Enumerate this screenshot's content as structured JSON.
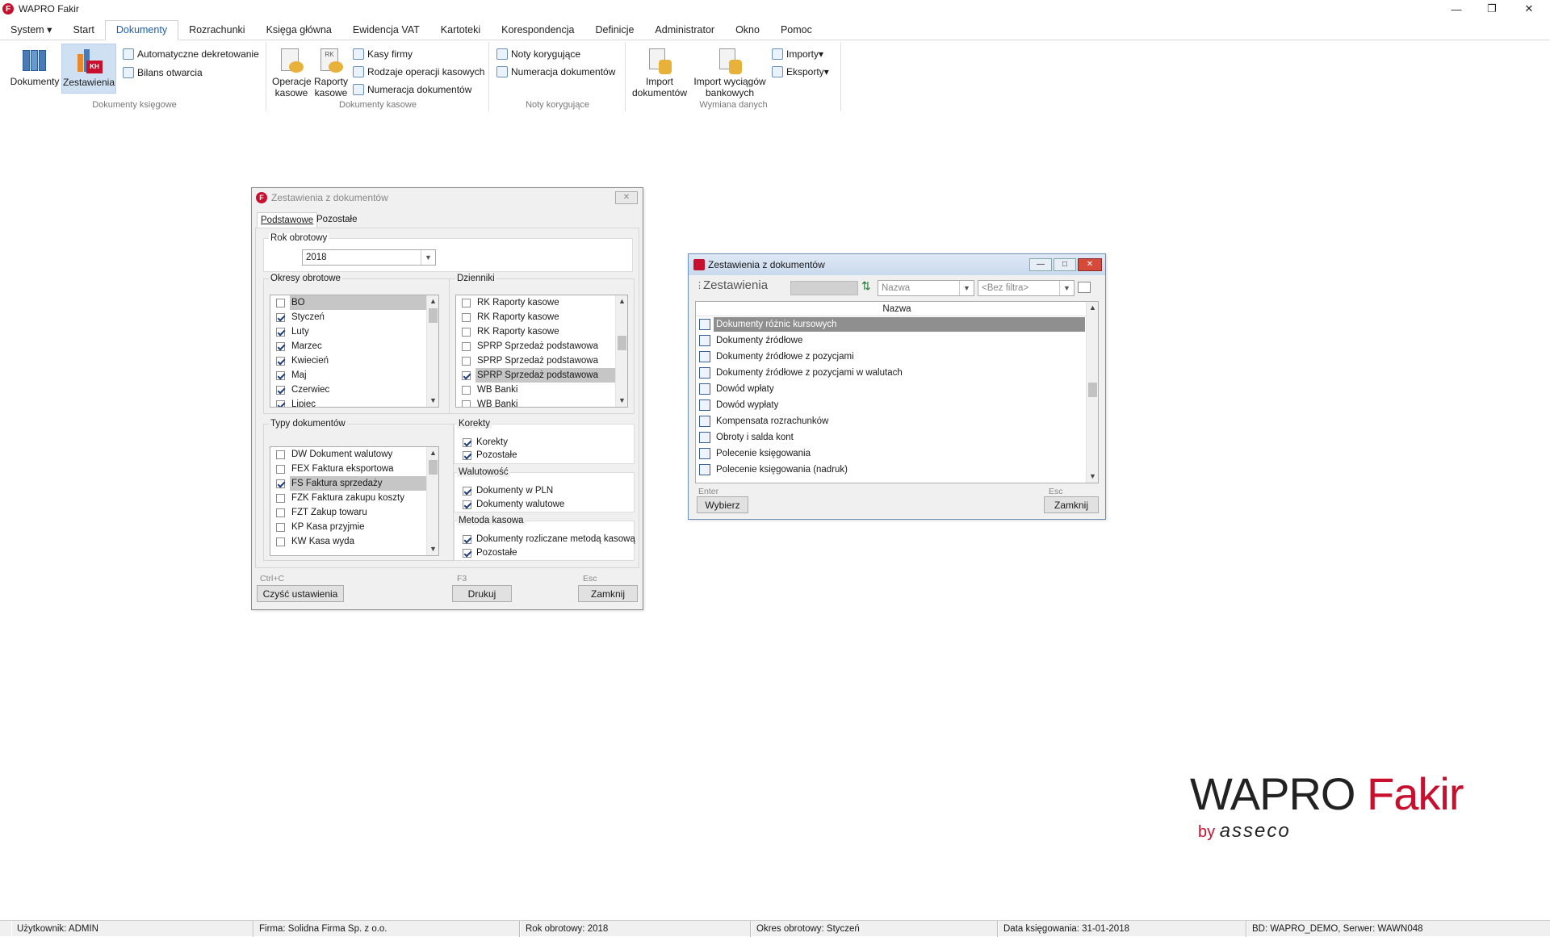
{
  "app": {
    "title": "WAPRO Fakir",
    "icon_letter": "F"
  },
  "menu": [
    "System",
    "Start",
    "Dokumenty",
    "Rozrachunki",
    "Księga główna",
    "Ewidencja VAT",
    "Kartoteki",
    "Korespondencja",
    "Definicje",
    "Administrator",
    "Okno",
    "Pomoc"
  ],
  "ribbon": {
    "g1": {
      "label": "Dokumenty księgowe",
      "btn1": "Dokumenty",
      "btn2": "Zestawienia",
      "btn2_badge": "KH",
      "s1": "Automatyczne dekretowanie",
      "s2": "Bilans otwarcia"
    },
    "g2": {
      "label": "Dokumenty kasowe",
      "b1a": "Operacje",
      "b1b": "kasowe",
      "b2a": "Raporty",
      "b2b": "kasowe",
      "s1": "Kasy firmy",
      "s2": "Rodzaje operacji kasowych",
      "s3": "Numeracja dokumentów"
    },
    "g3": {
      "label": "Noty korygujące",
      "s1": "Noty korygujące",
      "s2": "Numeracja dokumentów"
    },
    "g4": {
      "label": "Wymiana danych",
      "b1a": "Import",
      "b1b": "dokumentów",
      "b2a": "Import wyciągów",
      "b2b": "bankowych",
      "s1": "Importy",
      "s2": "Eksporty"
    }
  },
  "dialog1": {
    "title": "Zestawienia z dokumentów",
    "tabs": [
      "Podstawowe",
      "Pozostałe"
    ],
    "rok_label": "Rok obrotowy",
    "rok_value": "2018",
    "okresy_label": "Okresy obrotowe",
    "okresy": [
      {
        "t": "BO",
        "c": false,
        "s": true
      },
      {
        "t": "Styczeń",
        "c": true
      },
      {
        "t": "Luty",
        "c": true
      },
      {
        "t": "Marzec",
        "c": true
      },
      {
        "t": "Kwiecień",
        "c": true
      },
      {
        "t": "Maj",
        "c": true
      },
      {
        "t": "Czerwiec",
        "c": true
      },
      {
        "t": "Lipiec",
        "c": true
      }
    ],
    "dzienniki_label": "Dzienniki",
    "dzienniki": [
      {
        "t": "RK Raporty kasowe",
        "c": false
      },
      {
        "t": "RK Raporty kasowe",
        "c": false
      },
      {
        "t": "RK Raporty kasowe",
        "c": false
      },
      {
        "t": "SPRP Sprzedaż podstawowa",
        "c": false
      },
      {
        "t": "SPRP Sprzedaż podstawowa",
        "c": false
      },
      {
        "t": "SPRP Sprzedaż podstawowa",
        "c": true,
        "s": true
      },
      {
        "t": "WB Banki",
        "c": false
      },
      {
        "t": "WB Banki",
        "c": false
      }
    ],
    "typy_label": "Typy dokumentów",
    "typy": [
      {
        "t": "DW Dokument walutowy",
        "c": false
      },
      {
        "t": "FEX Faktura eksportowa",
        "c": false
      },
      {
        "t": "FS Faktura sprzedaży",
        "c": true,
        "s": true
      },
      {
        "t": "FZK Faktura zakupu koszty",
        "c": false
      },
      {
        "t": "FZT Zakup towaru",
        "c": false
      },
      {
        "t": "KP Kasa przyjmie",
        "c": false
      },
      {
        "t": "KW Kasa wyda",
        "c": false
      }
    ],
    "korekty_label": "Korekty",
    "korekty": [
      "Korekty",
      "Pozostałe"
    ],
    "walutowosc_label": "Walutowość",
    "walutowosc": [
      "Dokumenty w PLN",
      "Dokumenty walutowe"
    ],
    "metoda_label": "Metoda kasowa",
    "metoda": [
      "Dokumenty rozliczane metodą kasową",
      "Pozostałe"
    ],
    "hint1": "Ctrl+C",
    "btn1": "Czyść ustawienia",
    "hint2": "F3",
    "btn2": "Drukuj",
    "hint3": "Esc",
    "btn3": "Zamknij"
  },
  "dialog2": {
    "title": "Zestawienia z dokumentów",
    "heading": "Zestawienia",
    "sort_combo": "Nazwa",
    "filter_combo": "<Bez filtra>",
    "col_header": "Nazwa",
    "items": [
      "Dokumenty różnic kursowych",
      "Dokumenty źródłowe",
      "Dokumenty źródłowe z pozycjami",
      "Dokumenty źródłowe z pozycjami w walutach",
      "Dowód wpłaty",
      "Dowód wypłaty",
      "Kompensata rozrachunków",
      "Obroty i salda kont",
      "Polecenie księgowania",
      "Polecenie księgowania (nadruk)"
    ],
    "hint1": "Enter",
    "btn1": "Wybierz",
    "hint2": "Esc",
    "btn2": "Zamknij"
  },
  "logo": {
    "w1": "WAPRO",
    "w2": "Fakir",
    "by": "by",
    "brand": "asseco"
  },
  "status": [
    "Użytkownik: ADMIN",
    "Firma: Solidna Firma Sp. z o.o.",
    "Rok obrotowy: 2018",
    "Okres obrotowy: Styczeń",
    "Data księgowania: 31-01-2018",
    "BD: WAPRO_DEMO, Serwer: WAWN048"
  ],
  "colors": {
    "brand_red": "#c8102e",
    "accent_blue": "#1e5fa8"
  }
}
